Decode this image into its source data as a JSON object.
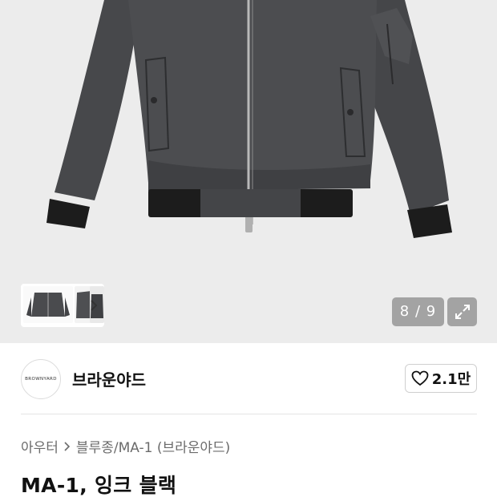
{
  "gallery": {
    "counter": "8 / 9",
    "icons": {
      "next": "chevron-right-icon",
      "expand": "expand-arrows-icon"
    }
  },
  "brand": {
    "logo_text": "BROWNYARD",
    "name": "브라운야드",
    "like_count": "2.1만",
    "like_icon": "heart-outline-icon"
  },
  "breadcrumb": {
    "items": [
      "아우터",
      "블루종/MA-1 (브라운야드)"
    ],
    "separator_icon": "chevron-right-icon"
  },
  "product": {
    "title": "MA-1, 잉크 블랙"
  },
  "colors": {
    "hero_bg": "#ececec",
    "jacket": "#4a4b4e",
    "rib": "#1c1c1c",
    "counter_bg": "#a3a3a3"
  }
}
